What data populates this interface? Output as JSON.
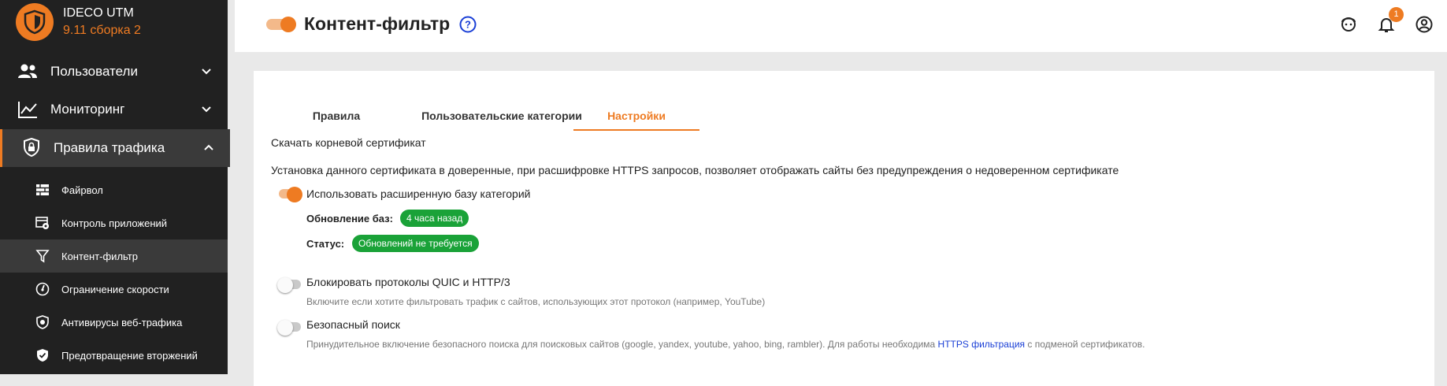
{
  "brand": {
    "name": "IDECO UTM",
    "version": "9.11 сборка 2"
  },
  "sidebar": {
    "top_items": [
      {
        "label": "Пользователи"
      },
      {
        "label": "Мониторинг"
      },
      {
        "label": "Правила трафика"
      }
    ],
    "sub_items": [
      {
        "label": "Файрвол"
      },
      {
        "label": "Контроль приложений"
      },
      {
        "label": "Контент-фильтр"
      },
      {
        "label": "Ограничение скорости"
      },
      {
        "label": "Антивирусы веб-трафика"
      },
      {
        "label": "Предотвращение вторжений"
      }
    ]
  },
  "header": {
    "title": "Контент-фильтр",
    "notification_count": "1"
  },
  "tabs": [
    {
      "label": "Правила"
    },
    {
      "label": "Пользовательские категории"
    },
    {
      "label": "Настройки"
    }
  ],
  "settings": {
    "download_link": "Скачать корневой сертификат",
    "cert_description": "Установка данного сертификата в доверенные, при расшифровке HTTPS запросов, позволяет отображать сайты без предупреждения о недоверенном сертификате",
    "extended_db_label": "Использовать расширенную базу категорий",
    "update_label": "Обновление баз:",
    "update_value": "4 часа назад",
    "status_label": "Статус:",
    "status_value": "Обновлений не требуется",
    "quic_label": "Блокировать протоколы QUIC и HTTP/3",
    "quic_hint": "Включите если хотите фильтровать трафик с сайтов, использующих этот протокол (например, YouTube)",
    "safe_label": "Безопасный поиск",
    "safe_hint_before": "Принудительное включение безопасного поиска для поисковых сайтов (google, yandex, youtube, yahoo, bing, rambler). Для работы необходима",
    "safe_hint_link": "HTTPS фильтрация",
    "safe_hint_after": "с подменой сертификатов."
  },
  "colors": {
    "accent": "#ee7b22",
    "sidebar_bg": "#212121",
    "success": "#1aa238",
    "link": "#1a3fd6"
  },
  "icons": [
    "shield-logo-icon",
    "users-icon",
    "chart-line-icon",
    "shield-lock-icon",
    "chevron-down-icon",
    "chevron-up-icon",
    "brick-wall-icon",
    "app-control-icon",
    "filter-icon",
    "speedometer-icon",
    "antivirus-shield-icon",
    "shield-check-icon",
    "help-circle-icon",
    "support-agent-icon",
    "bell-icon",
    "account-circle-icon"
  ]
}
